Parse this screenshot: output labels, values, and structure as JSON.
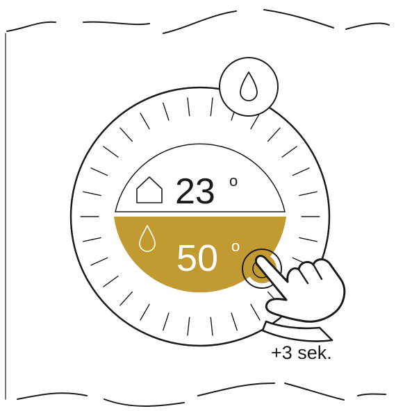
{
  "display": {
    "room_temperature": "23",
    "degree_symbol": "o",
    "water_temperature": "50",
    "water_degree_symbol": "o"
  },
  "hold_instruction": "+3 sek.",
  "colors": {
    "line": "#1a1a1a",
    "water_panel": "#c29a32",
    "water_text": "#ffffff",
    "background": "#ffffff"
  },
  "icons": {
    "top_button": "water-drop-icon",
    "room": "house-icon",
    "water": "water-drop-icon",
    "pointer": "hand-pointer-icon"
  }
}
